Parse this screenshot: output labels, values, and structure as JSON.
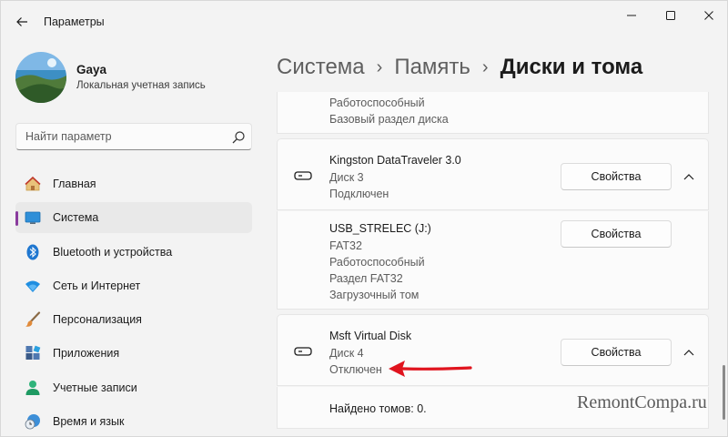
{
  "window": {
    "title": "Параметры",
    "back_icon": "arrow-left-icon",
    "controls": [
      "minimize-icon",
      "maximize-icon",
      "close-icon"
    ]
  },
  "profile": {
    "name": "Gaya",
    "account_type": "Локальная учетная запись"
  },
  "search": {
    "placeholder": "Найти параметр",
    "icon": "search-icon"
  },
  "nav": {
    "items": [
      {
        "label": "Главная",
        "icon": "home-icon"
      },
      {
        "label": "Система",
        "icon": "system-icon",
        "selected": true
      },
      {
        "label": "Bluetooth и устройства",
        "icon": "bluetooth-icon"
      },
      {
        "label": "Сеть и Интернет",
        "icon": "wifi-icon"
      },
      {
        "label": "Персонализация",
        "icon": "brush-icon"
      },
      {
        "label": "Приложения",
        "icon": "apps-icon"
      },
      {
        "label": "Учетные записи",
        "icon": "user-icon"
      },
      {
        "label": "Время и язык",
        "icon": "clock-globe-icon"
      }
    ],
    "accent_color": "#8a3c9e"
  },
  "breadcrumb": {
    "items": [
      "Система",
      "Память"
    ],
    "current": "Диски и тома"
  },
  "volumes": {
    "partial_card": {
      "status": "Работоспособный",
      "type": "Базовый раздел диска"
    },
    "disk1": {
      "name": "Kingston DataTraveler 3.0",
      "number": "Диск 3",
      "state": "Подключен",
      "button": "Свойства"
    },
    "volume1": {
      "name": "USB_STRELEC (J:)",
      "fs": "FAT32",
      "status": "Работоспособный",
      "type": "Раздел FAT32",
      "role": "Загрузочный том",
      "button": "Свойства"
    },
    "disk2": {
      "name": "Msft Virtual Disk",
      "number": "Диск 4",
      "state": "Отключен",
      "button": "Свойства"
    },
    "disk2_volumes": {
      "found": "Найдено томов: 0."
    }
  },
  "annotation": {
    "arrow_color": "#e0141e"
  },
  "watermark": "RemontCompa.ru"
}
